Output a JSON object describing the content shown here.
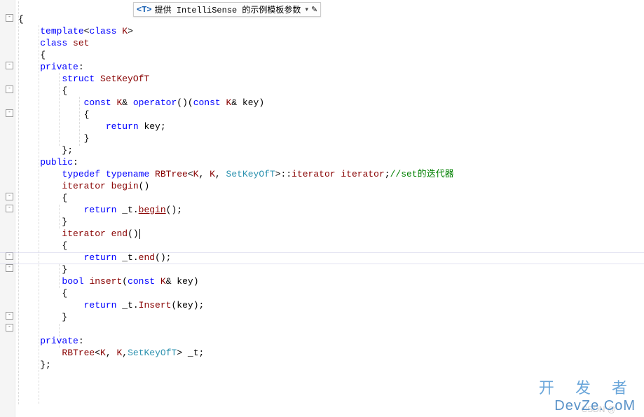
{
  "tooltip": {
    "param": "<T>",
    "text": "提供 IntelliSense 的示例模板参数",
    "dropdown": "▾",
    "edit": "✎"
  },
  "code": {
    "l0a": "{",
    "l1_kw1": "template",
    "l1_op1": "<",
    "l1_kw2": "class",
    "l1_id": " K",
    "l1_op2": ">",
    "l2_kw": "class",
    "l2_id": " set",
    "l3": "    {",
    "l4_kw": "private",
    "l4_c": ":",
    "l5_kw": "struct",
    "l5_id": " SetKeyOfT",
    "l6": "        {",
    "l7_kw1": "const",
    "l7_id1": " K",
    "l7_op1": "& ",
    "l7_kw2": "operator",
    "l7_op2": "()(",
    "l7_kw3": "const",
    "l7_id2": " K",
    "l7_op3": "& ",
    "l7_id3": "key",
    "l7_op4": ")",
    "l8": "            {",
    "l9_kw": "return",
    "l9_id": " key",
    "l9_op": ";",
    "l10": "            }",
    "l11": "        };",
    "l12_kw": "public",
    "l12_c": ":",
    "l13_kw1": "typedef",
    "l13_kw2": " typename",
    "l13_t": " RBTree",
    "l13_op1": "<",
    "l13_id1": "K",
    "l13_c1": ", ",
    "l13_id2": "K",
    "l13_c2": ", ",
    "l13_t2": "SetKeyOfT",
    "l13_op2": ">::",
    "l13_id3": "iterator",
    "l13_id4": " iterator",
    "l13_op3": ";",
    "l13_cm": "//set的迭代器",
    "l14_t": "iterator",
    "l14_f": " begin",
    "l14_op": "()",
    "l15": "        {",
    "l16_kw": "return",
    "l16_id": " _t",
    "l16_op1": ".",
    "l16_f": "begin",
    "l16_op2": "();",
    "l17": "        }",
    "l18_t": "iterator",
    "l18_f": " end",
    "l18_op": "()",
    "l19": "        {",
    "l20_kw": "return",
    "l20_id": " _t",
    "l20_op1": ".",
    "l20_f": "end",
    "l20_op2": "();",
    "l21": "        }",
    "l22_kw1": "bool",
    "l22_f": " insert",
    "l22_op1": "(",
    "l22_kw2": "const",
    "l22_id1": " K",
    "l22_op2": "& ",
    "l22_id2": "key",
    "l22_op3": ")",
    "l23": "        {",
    "l24_kw": "return",
    "l24_id": " _t",
    "l24_op1": ".",
    "l24_f": "Insert",
    "l24_op2": "(",
    "l24_id2": "key",
    "l24_op3": ");",
    "l25": "        }",
    "l26": "",
    "l27_kw": "private",
    "l27_c": ":",
    "l28_t": "RBTree",
    "l28_op1": "<",
    "l28_id1": "K",
    "l28_c1": ", ",
    "l28_id2": "K",
    "l28_c2": ",",
    "l28_t2": "SetKeyOfT",
    "l28_op2": "> ",
    "l28_id3": "_t",
    "l28_op3": ";",
    "l29": "    };"
  },
  "watermark": {
    "line1": "开 发 者",
    "line2": "DevZe.CoM"
  },
  "csdn": "CSDN @"
}
